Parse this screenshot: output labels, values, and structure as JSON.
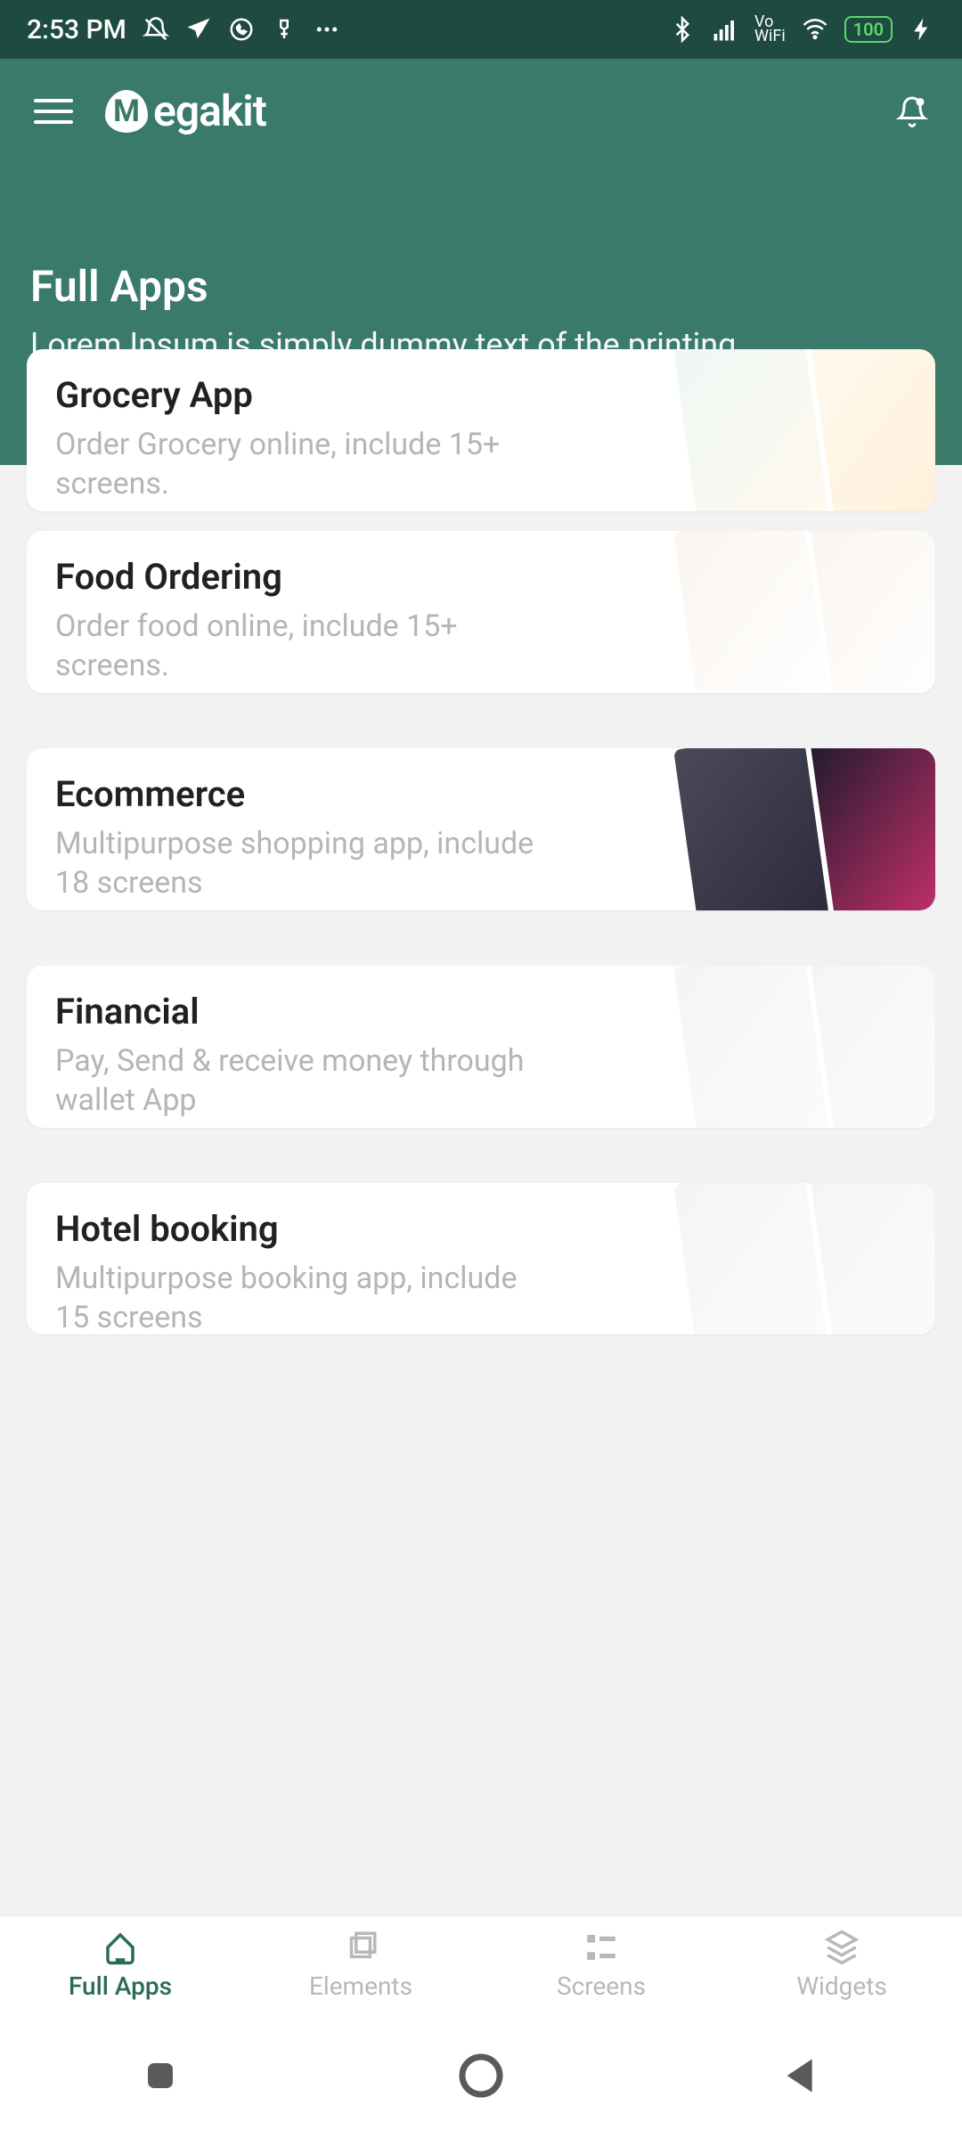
{
  "status": {
    "time": "2:53 PM",
    "battery": "100"
  },
  "header": {
    "brand": "egakit",
    "brand_letter": "M"
  },
  "hero": {
    "title": "Full Apps",
    "subtitle": "Lorem Ipsum is simply dummy text of the printing."
  },
  "cards": [
    {
      "title": "Grocery App",
      "desc": "Order Grocery online, include 15+ screens."
    },
    {
      "title": "Food Ordering",
      "desc": "Order food online, include 15+ screens."
    },
    {
      "title": "Ecommerce",
      "desc": "Multipurpose shopping app, include 18 screens"
    },
    {
      "title": "Financial",
      "desc": "Pay, Send & receive money through wallet App"
    },
    {
      "title": "Hotel booking",
      "desc": "Multipurpose booking app, include 15 screens"
    }
  ],
  "nav": {
    "items": [
      {
        "label": "Full Apps",
        "active": true
      },
      {
        "label": "Elements",
        "active": false
      },
      {
        "label": "Screens",
        "active": false
      },
      {
        "label": "Widgets",
        "active": false
      }
    ]
  }
}
